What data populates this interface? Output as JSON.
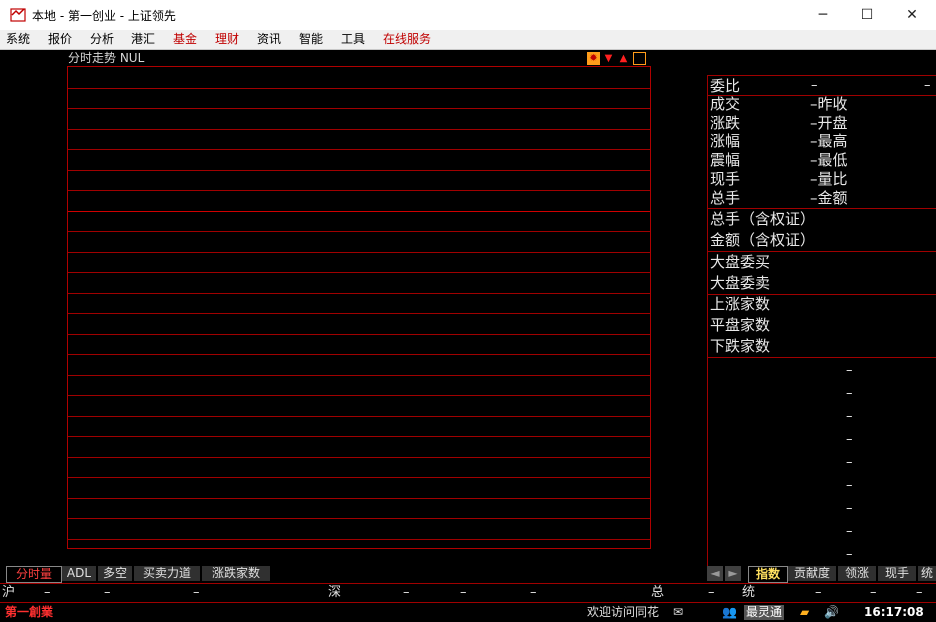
{
  "window": {
    "title": "本地 - 第一创业 - 上证领先",
    "minimize": "─",
    "maximize": "☐",
    "close": "✕"
  },
  "menu": {
    "items": [
      {
        "label": "系统",
        "red": false
      },
      {
        "label": "报价",
        "red": false
      },
      {
        "label": "分析",
        "red": false
      },
      {
        "label": "港汇",
        "red": false
      },
      {
        "label": "基金",
        "red": true
      },
      {
        "label": "理财",
        "red": true
      },
      {
        "label": "资讯",
        "red": false
      },
      {
        "label": "智能",
        "red": false
      },
      {
        "label": "工具",
        "red": false
      },
      {
        "label": "在线服务",
        "red": true
      }
    ]
  },
  "chart": {
    "title": "分时走势  NUL"
  },
  "quote_panel": {
    "weibi": "委比",
    "weibi_val": "–",
    "weibi_val2": "–",
    "rows": [
      {
        "l": "成交",
        "m": "–昨收"
      },
      {
        "l": "涨跌",
        "m": "–开盘"
      },
      {
        "l": "涨幅",
        "m": "–最高"
      },
      {
        "l": "震幅",
        "m": "–最低"
      },
      {
        "l": "现手",
        "m": "–量比"
      },
      {
        "l": "总手",
        "m": "–金额"
      }
    ],
    "rows2": [
      "总手（含权证）",
      "金额（含权证）"
    ],
    "rows3": [
      "大盘委买",
      "大盘委卖"
    ],
    "rows4": [
      "上涨家数",
      "平盘家数",
      "下跌家数"
    ],
    "dash": "–"
  },
  "tabs": {
    "left": [
      "分时量",
      "ADL",
      "多空",
      "买卖力道",
      "涨跌家数"
    ],
    "right": [
      "指数",
      "贡献度",
      "领涨",
      "现手",
      "统"
    ],
    "nav_prev": "◄",
    "nav_next": "►"
  },
  "status1": {
    "hu": "沪",
    "shen": "深",
    "zong": "总",
    "tong": "统",
    "dash": "–"
  },
  "status2": {
    "brand": "第一創業",
    "welcome": "欢迎访问同花",
    "bulletin": "最灵通",
    "time": "16:17:08"
  },
  "colors": {
    "grid": "#a00000",
    "panel_border": "#a00000",
    "accent_yellow": "#ffe060"
  }
}
